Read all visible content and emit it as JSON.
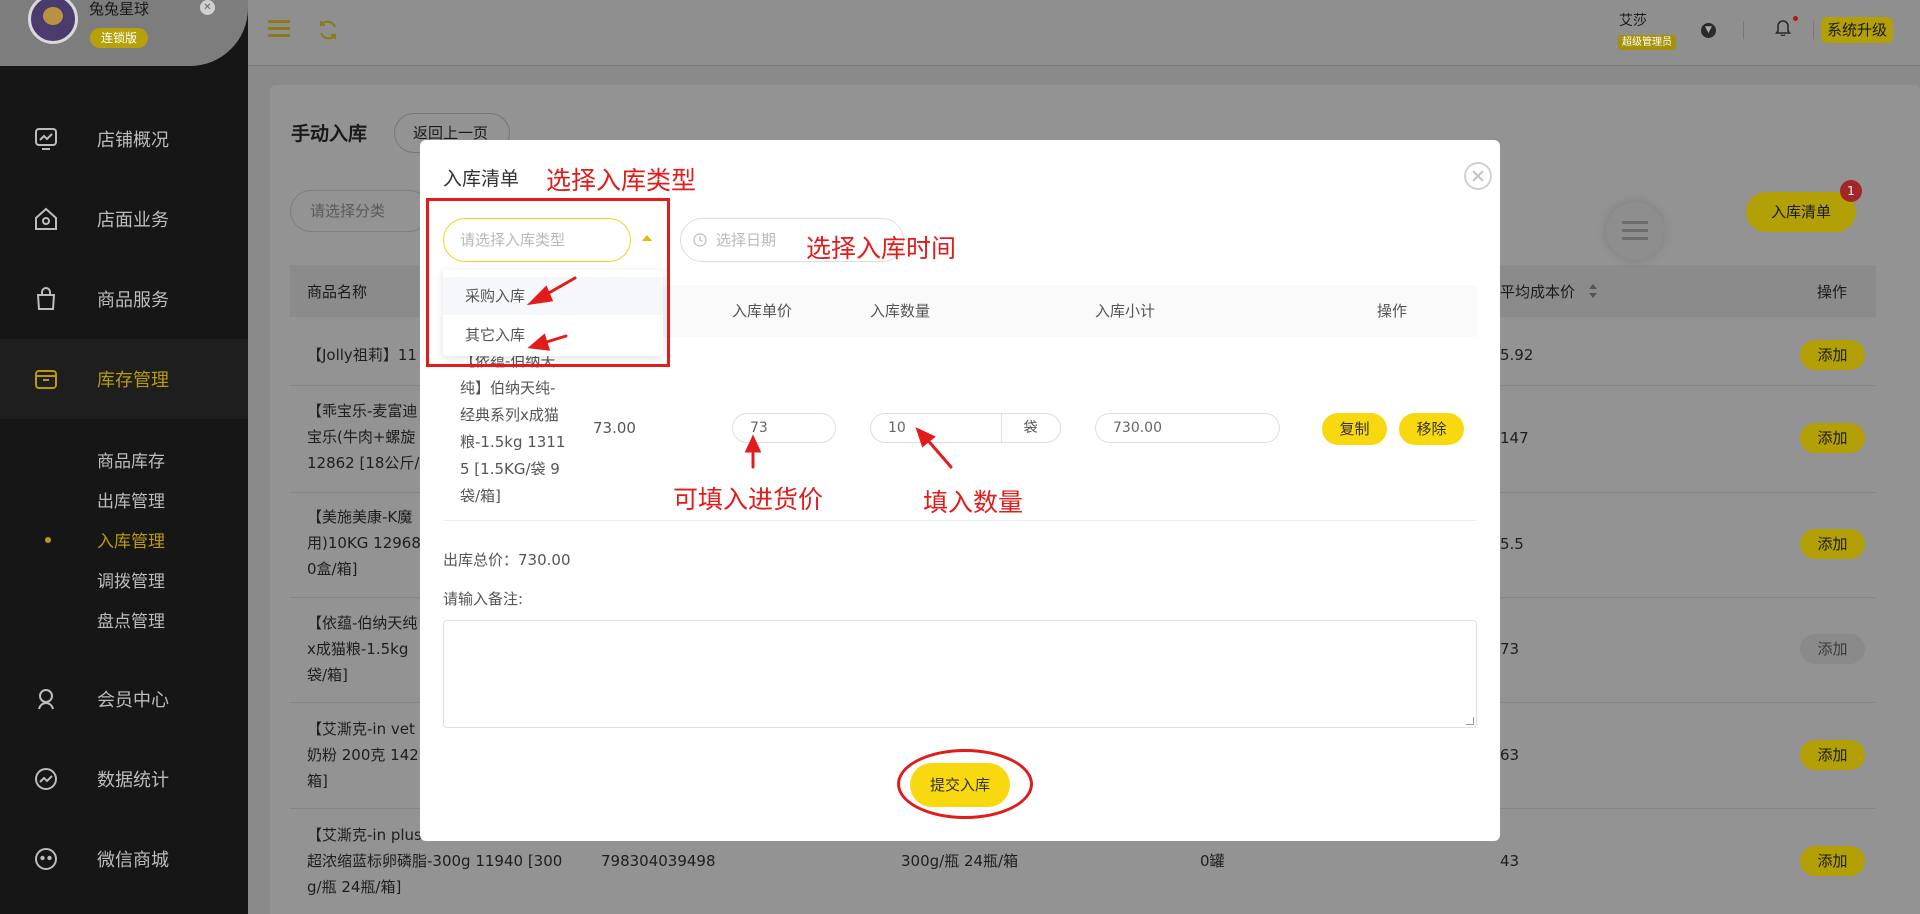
{
  "brand": {
    "name": "兔兔星球",
    "edition": "连锁版"
  },
  "sidebar": {
    "items": [
      {
        "label": "店铺概况",
        "icon": "monitor-chart-icon"
      },
      {
        "label": "店面业务",
        "icon": "store-house-icon"
      },
      {
        "label": "商品服务",
        "icon": "shopping-bag-icon"
      },
      {
        "label": "库存管理",
        "icon": "inventory-box-icon",
        "active": true
      },
      {
        "label": "会员中心",
        "icon": "member-user-icon"
      },
      {
        "label": "数据统计",
        "icon": "stats-chart-icon"
      },
      {
        "label": "微信商城",
        "icon": "wechat-shop-icon"
      }
    ],
    "sub_items": [
      "商品库存",
      "出库管理",
      "入库管理",
      "调拨管理",
      "盘点管理"
    ],
    "active_sub": "入库管理"
  },
  "header": {
    "user_name": "艾莎",
    "user_role": "超级管理员",
    "upgrade_label": "系统升级"
  },
  "page": {
    "title": "手动入库",
    "back_label": "返回上一页",
    "category_placeholder": "请选择分类",
    "stock_list_label": "入库清单",
    "stock_list_badge": "1",
    "columns": [
      "商品名称",
      "平均成本价",
      "操作"
    ],
    "add_label": "添加",
    "rows": [
      {
        "name": "【Jolly祖莉】11",
        "avg_cost": "5.92"
      },
      {
        "name": "【乖宝乐-麦富迪\n宝乐(牛肉+螺旋\n12862 [18公斤/",
        "avg_cost": "147"
      },
      {
        "name": "【美施美康-K魔\n用)10KG 12968\n0盒/箱]",
        "avg_cost": "5.5"
      },
      {
        "name": "【依蕴-伯纳天纯\nx成猫粮-1.5kg\n袋/箱]",
        "avg_cost": "73"
      },
      {
        "name": "【艾澌克-in vet\n奶粉 200克 142\n箱]",
        "avg_cost": "63"
      },
      {
        "name": "【艾澌克-in plus\n超浓缩蓝标卵磷脂-300g 11940 [300\ng/瓶 24瓶/箱]",
        "barcode": "798304039498",
        "spec": "300g/瓶 24瓶/箱",
        "stock": "0罐",
        "avg_cost": "43"
      }
    ]
  },
  "modal": {
    "title": "入库清单",
    "type_placeholder": "请选择入库类型",
    "date_placeholder": "选择日期",
    "type_options": [
      "采购入库",
      "其它入库"
    ],
    "columns": [
      "入库单价",
      "入库数量",
      "入库小计",
      "操作"
    ],
    "item": {
      "name": "【依蕴-伯纳天\n纯】伯纳天纯-\n经典系列x成猫\n粮-1.5kg 1311\n5 [1.5KG/袋 9\n袋/箱]",
      "cost": "73.00",
      "unit_price": "73",
      "quantity": "10",
      "unit": "袋",
      "subtotal": "730.00"
    },
    "copy_label": "复制",
    "remove_label": "移除",
    "total_text": "出库总价：730.00",
    "note_label": "请输入备注:",
    "submit_label": "提交入库"
  },
  "annotations": {
    "select_type": "选择入库类型",
    "select_time": "选择入库时间",
    "price_hint": "可填入进货价",
    "quantity_hint": "填入数量"
  },
  "colors": {
    "accent": "#f8d90f",
    "sidebar_bg": "#161616",
    "annotation": "#e21b1b"
  }
}
